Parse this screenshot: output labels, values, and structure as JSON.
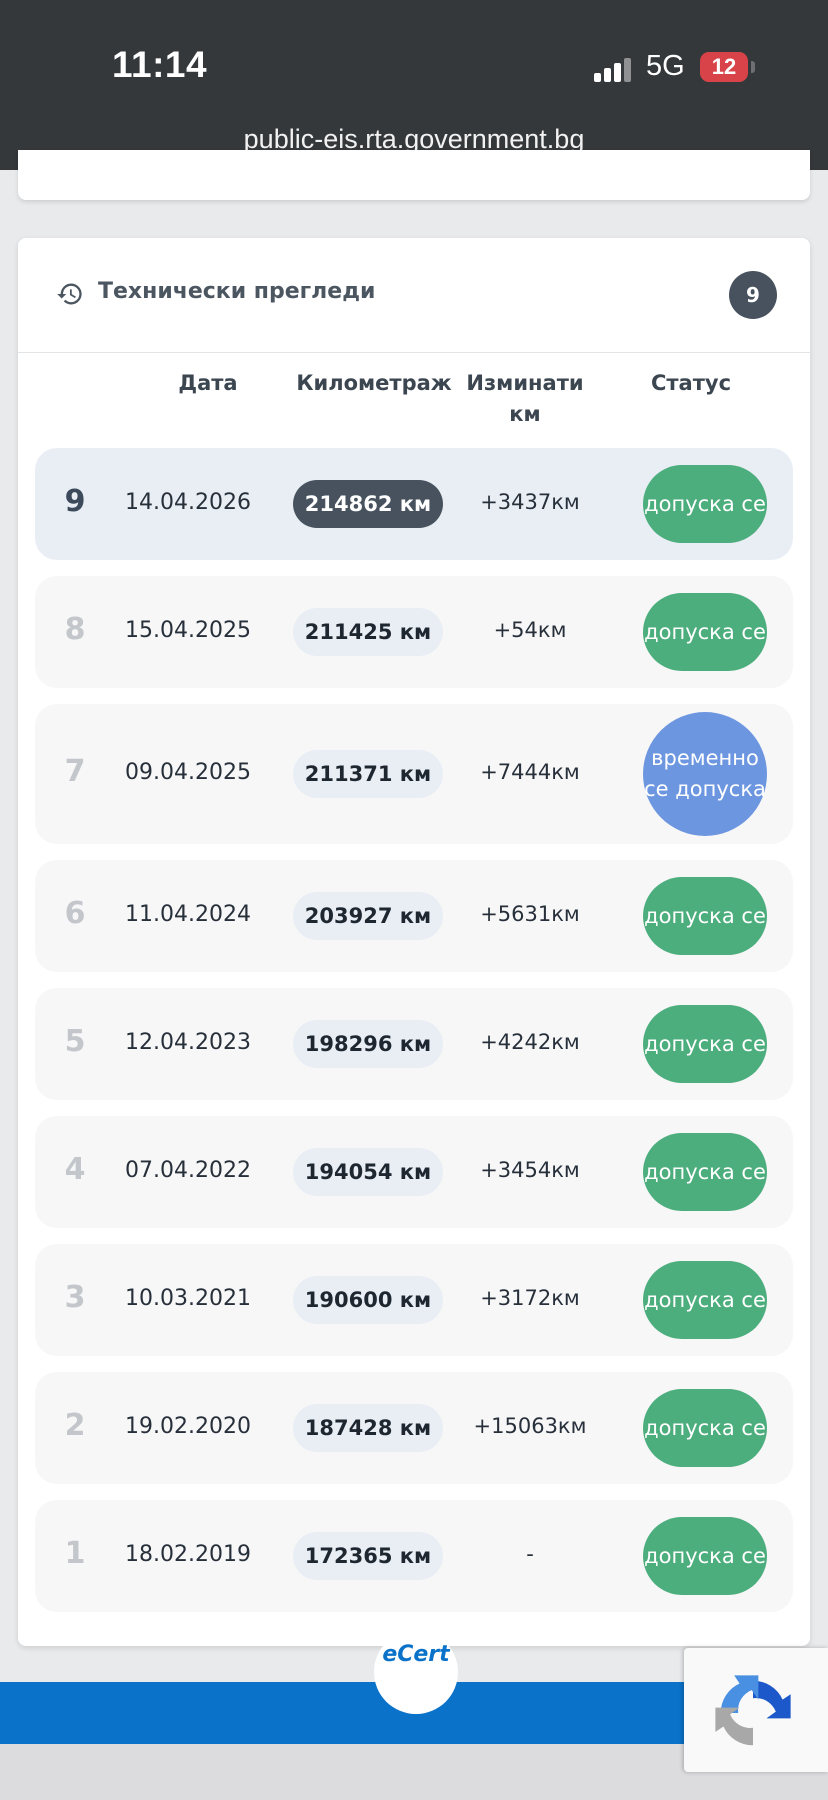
{
  "status_bar": {
    "time": "11:14",
    "network": "5G",
    "battery": "12"
  },
  "browser": {
    "url": "public-eis.rta.government.bg"
  },
  "inspections": {
    "title": "Технически прегледи",
    "count": "9",
    "columns": {
      "date": "Дата",
      "mileage": "Километраж",
      "driven": "Изминати км",
      "status": "Статус"
    },
    "rows": [
      {
        "num": "9",
        "date": "14.04.2026",
        "km": "214862 км",
        "diff": "+3437км",
        "status": "допуска се"
      },
      {
        "num": "8",
        "date": "15.04.2025",
        "km": "211425 км",
        "diff": "+54км",
        "status": "допуска се"
      },
      {
        "num": "7",
        "date": "09.04.2025",
        "km": "211371 км",
        "diff": "+7444км",
        "status": "временно се допуска"
      },
      {
        "num": "6",
        "date": "11.04.2024",
        "km": "203927 км",
        "diff": "+5631км",
        "status": "допуска се"
      },
      {
        "num": "5",
        "date": "12.04.2023",
        "km": "198296 км",
        "diff": "+4242км",
        "status": "допуска се"
      },
      {
        "num": "4",
        "date": "07.04.2022",
        "km": "194054 км",
        "diff": "+3454км",
        "status": "допуска се"
      },
      {
        "num": "3",
        "date": "10.03.2021",
        "km": "190600 км",
        "diff": "+3172км",
        "status": "допуска се"
      },
      {
        "num": "2",
        "date": "19.02.2020",
        "km": "187428 км",
        "diff": "+15063км",
        "status": "допуска се"
      },
      {
        "num": "1",
        "date": "18.02.2019",
        "km": "172365 км",
        "diff": "-",
        "status": "допуска се"
      }
    ]
  },
  "footer": {
    "logo": "eCert"
  },
  "colors": {
    "ok": "#4cad7d",
    "temp": "#6d96e0",
    "badge": "#47525e",
    "footer_blue": "#0a72c9"
  },
  "icons": {
    "header": "history-icon",
    "captcha": "recaptcha-icon"
  }
}
